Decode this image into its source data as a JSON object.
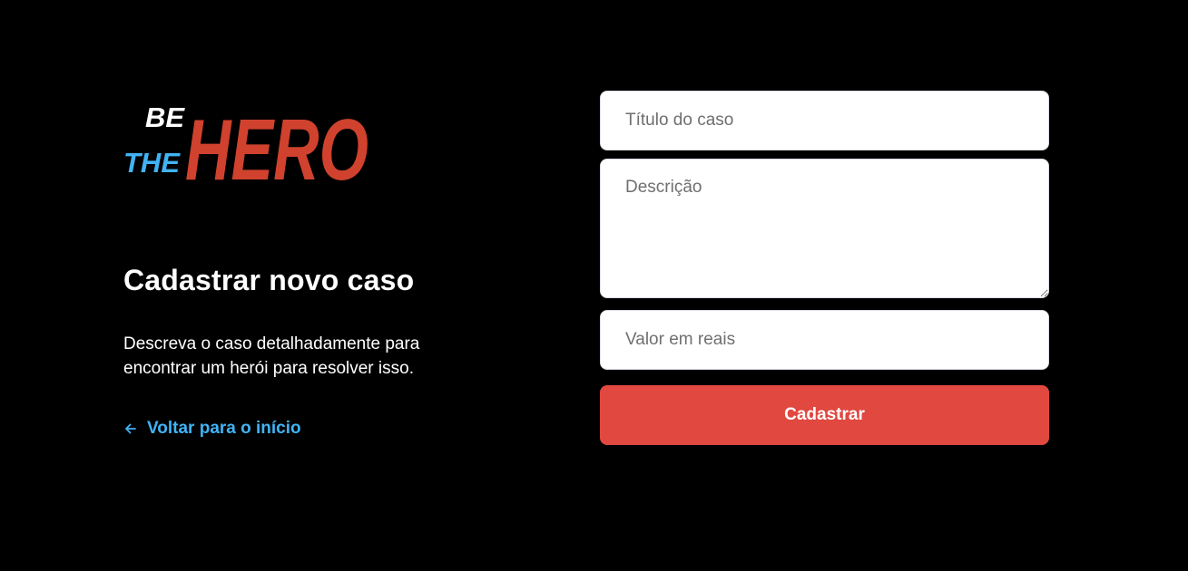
{
  "logo": {
    "line1": "BE",
    "line2": "THE",
    "word": "HERO",
    "colors": {
      "be": "#ffffff",
      "the": "#41b3f5",
      "hero": "#d0422e"
    }
  },
  "heading": "Cadastrar novo caso",
  "description": "Descreva o caso detalhadamente para encontrar um herói para resolver isso.",
  "back_link": {
    "icon": "arrow-left-icon",
    "label": "Voltar para o início"
  },
  "form": {
    "title_placeholder": "Título do caso",
    "description_placeholder": "Descrição",
    "value_placeholder": "Valor em reais",
    "submit_label": "Cadastrar"
  },
  "colors": {
    "background": "#000000",
    "accent_link": "#41b3f5",
    "button": "#e04840",
    "field_bg": "#ffffff"
  }
}
